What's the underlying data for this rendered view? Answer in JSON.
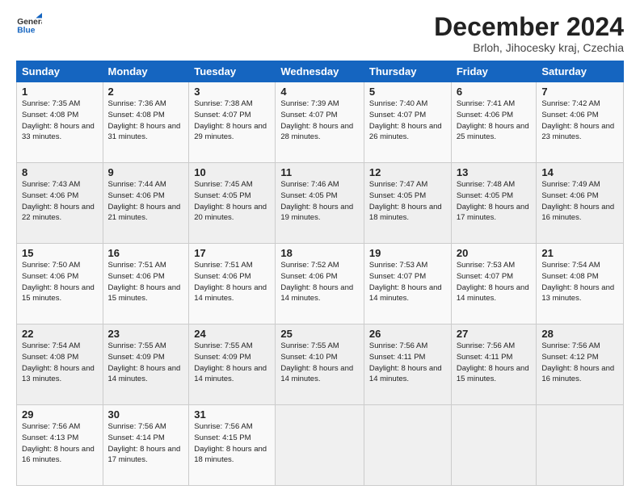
{
  "logo": {
    "line1": "General",
    "line2": "Blue"
  },
  "title": "December 2024",
  "subtitle": "Brloh, Jihocesky kraj, Czechia",
  "days_header": [
    "Sunday",
    "Monday",
    "Tuesday",
    "Wednesday",
    "Thursday",
    "Friday",
    "Saturday"
  ],
  "weeks": [
    [
      {
        "day": "1",
        "sunrise": "7:35 AM",
        "sunset": "4:08 PM",
        "daylight": "8 hours and 33 minutes."
      },
      {
        "day": "2",
        "sunrise": "7:36 AM",
        "sunset": "4:08 PM",
        "daylight": "8 hours and 31 minutes."
      },
      {
        "day": "3",
        "sunrise": "7:38 AM",
        "sunset": "4:07 PM",
        "daylight": "8 hours and 29 minutes."
      },
      {
        "day": "4",
        "sunrise": "7:39 AM",
        "sunset": "4:07 PM",
        "daylight": "8 hours and 28 minutes."
      },
      {
        "day": "5",
        "sunrise": "7:40 AM",
        "sunset": "4:07 PM",
        "daylight": "8 hours and 26 minutes."
      },
      {
        "day": "6",
        "sunrise": "7:41 AM",
        "sunset": "4:06 PM",
        "daylight": "8 hours and 25 minutes."
      },
      {
        "day": "7",
        "sunrise": "7:42 AM",
        "sunset": "4:06 PM",
        "daylight": "8 hours and 23 minutes."
      }
    ],
    [
      {
        "day": "8",
        "sunrise": "7:43 AM",
        "sunset": "4:06 PM",
        "daylight": "8 hours and 22 minutes."
      },
      {
        "day": "9",
        "sunrise": "7:44 AM",
        "sunset": "4:06 PM",
        "daylight": "8 hours and 21 minutes."
      },
      {
        "day": "10",
        "sunrise": "7:45 AM",
        "sunset": "4:05 PM",
        "daylight": "8 hours and 20 minutes."
      },
      {
        "day": "11",
        "sunrise": "7:46 AM",
        "sunset": "4:05 PM",
        "daylight": "8 hours and 19 minutes."
      },
      {
        "day": "12",
        "sunrise": "7:47 AM",
        "sunset": "4:05 PM",
        "daylight": "8 hours and 18 minutes."
      },
      {
        "day": "13",
        "sunrise": "7:48 AM",
        "sunset": "4:05 PM",
        "daylight": "8 hours and 17 minutes."
      },
      {
        "day": "14",
        "sunrise": "7:49 AM",
        "sunset": "4:06 PM",
        "daylight": "8 hours and 16 minutes."
      }
    ],
    [
      {
        "day": "15",
        "sunrise": "7:50 AM",
        "sunset": "4:06 PM",
        "daylight": "8 hours and 15 minutes."
      },
      {
        "day": "16",
        "sunrise": "7:51 AM",
        "sunset": "4:06 PM",
        "daylight": "8 hours and 15 minutes."
      },
      {
        "day": "17",
        "sunrise": "7:51 AM",
        "sunset": "4:06 PM",
        "daylight": "8 hours and 14 minutes."
      },
      {
        "day": "18",
        "sunrise": "7:52 AM",
        "sunset": "4:06 PM",
        "daylight": "8 hours and 14 minutes."
      },
      {
        "day": "19",
        "sunrise": "7:53 AM",
        "sunset": "4:07 PM",
        "daylight": "8 hours and 14 minutes."
      },
      {
        "day": "20",
        "sunrise": "7:53 AM",
        "sunset": "4:07 PM",
        "daylight": "8 hours and 14 minutes."
      },
      {
        "day": "21",
        "sunrise": "7:54 AM",
        "sunset": "4:08 PM",
        "daylight": "8 hours and 13 minutes."
      }
    ],
    [
      {
        "day": "22",
        "sunrise": "7:54 AM",
        "sunset": "4:08 PM",
        "daylight": "8 hours and 13 minutes."
      },
      {
        "day": "23",
        "sunrise": "7:55 AM",
        "sunset": "4:09 PM",
        "daylight": "8 hours and 14 minutes."
      },
      {
        "day": "24",
        "sunrise": "7:55 AM",
        "sunset": "4:09 PM",
        "daylight": "8 hours and 14 minutes."
      },
      {
        "day": "25",
        "sunrise": "7:55 AM",
        "sunset": "4:10 PM",
        "daylight": "8 hours and 14 minutes."
      },
      {
        "day": "26",
        "sunrise": "7:56 AM",
        "sunset": "4:11 PM",
        "daylight": "8 hours and 14 minutes."
      },
      {
        "day": "27",
        "sunrise": "7:56 AM",
        "sunset": "4:11 PM",
        "daylight": "8 hours and 15 minutes."
      },
      {
        "day": "28",
        "sunrise": "7:56 AM",
        "sunset": "4:12 PM",
        "daylight": "8 hours and 16 minutes."
      }
    ],
    [
      {
        "day": "29",
        "sunrise": "7:56 AM",
        "sunset": "4:13 PM",
        "daylight": "8 hours and 16 minutes."
      },
      {
        "day": "30",
        "sunrise": "7:56 AM",
        "sunset": "4:14 PM",
        "daylight": "8 hours and 17 minutes."
      },
      {
        "day": "31",
        "sunrise": "7:56 AM",
        "sunset": "4:15 PM",
        "daylight": "8 hours and 18 minutes."
      },
      null,
      null,
      null,
      null
    ]
  ],
  "labels": {
    "sunrise": "Sunrise:",
    "sunset": "Sunset:",
    "daylight": "Daylight:"
  }
}
